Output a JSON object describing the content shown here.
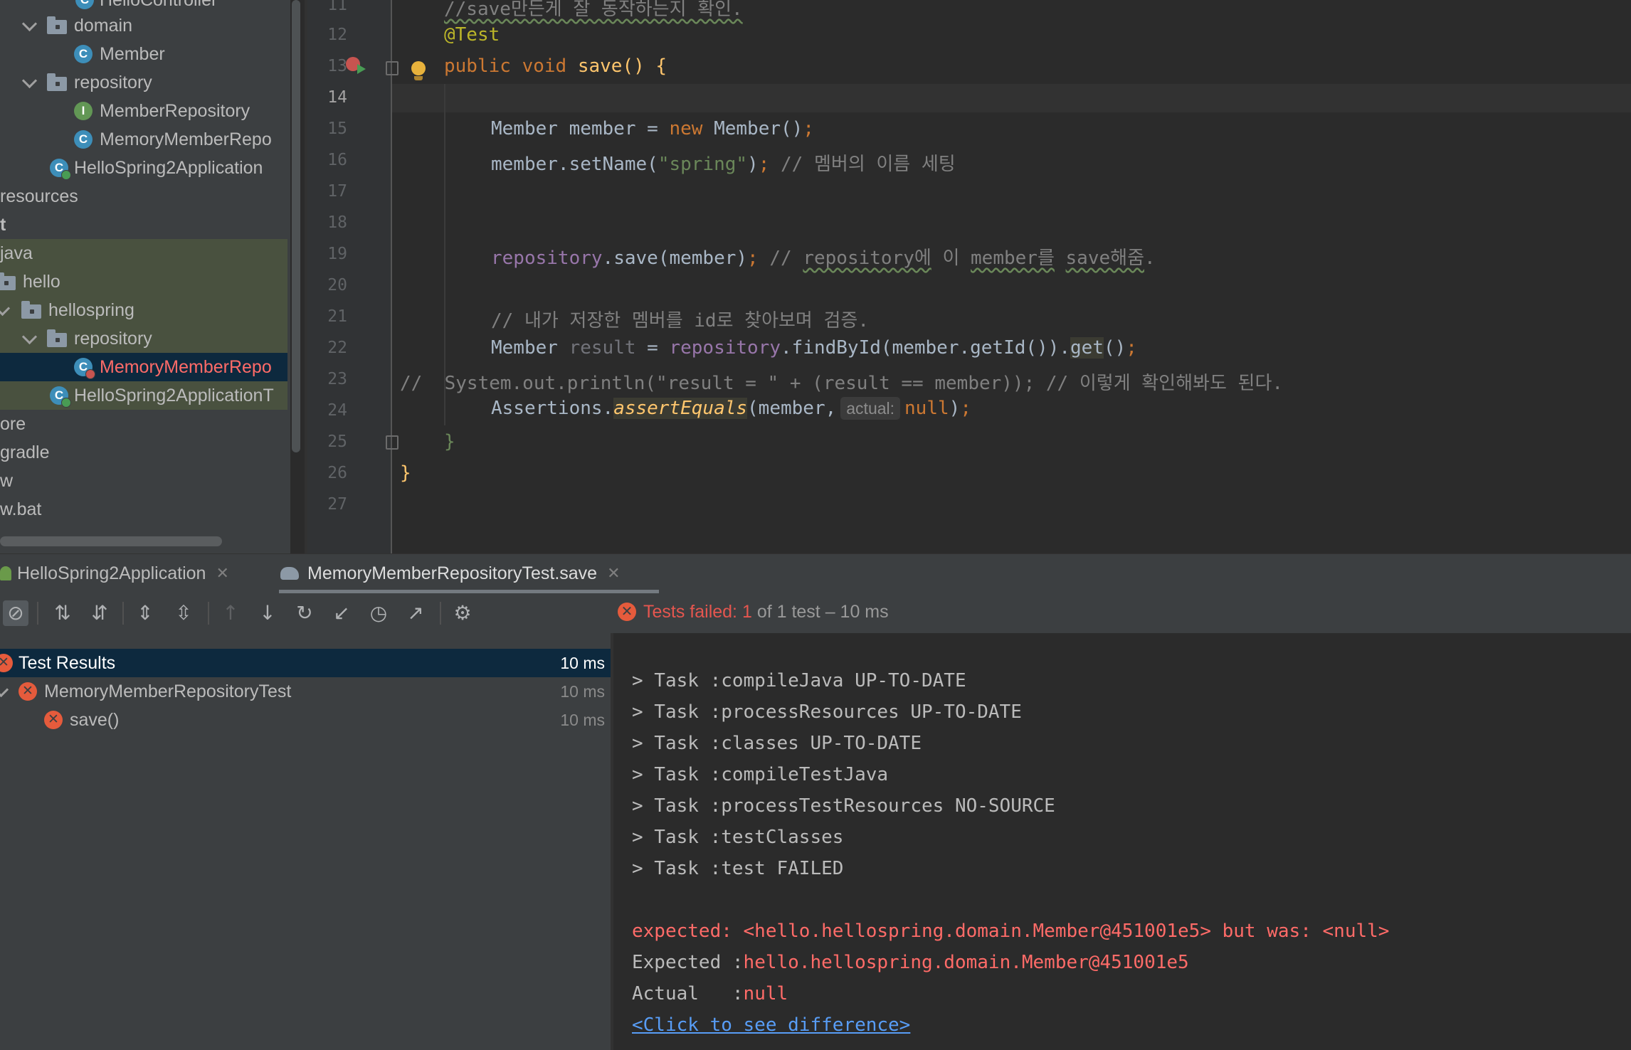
{
  "tree": {
    "items": [
      {
        "label": "HelloController",
        "icon": "class-icon",
        "glyph": "C"
      },
      {
        "label": "domain",
        "icon": "folder-icon"
      },
      {
        "label": "Member",
        "icon": "class-icon",
        "glyph": "C"
      },
      {
        "label": "repository",
        "icon": "folder-icon"
      },
      {
        "label": "MemberRepository",
        "icon": "interface-icon",
        "glyph": "I"
      },
      {
        "label": "MemoryMemberRepo",
        "icon": "class-icon",
        "glyph": "C"
      },
      {
        "label": "HelloSpring2Application",
        "icon": "spring-boot-class-icon",
        "glyph": "C"
      },
      {
        "label": "resources"
      },
      {
        "label": "t"
      },
      {
        "label": "java"
      },
      {
        "label": "hello",
        "icon": "folder-icon"
      },
      {
        "label": "hellospring",
        "icon": "folder-icon"
      },
      {
        "label": "repository",
        "icon": "folder-icon"
      },
      {
        "label": "MemoryMemberRepo",
        "icon": "test-class-icon",
        "glyph": "C"
      },
      {
        "label": "HelloSpring2ApplicationT",
        "icon": "test-class-icon",
        "glyph": "C"
      },
      {
        "label": "ore"
      },
      {
        "label": "gradle"
      },
      {
        "label": "w"
      },
      {
        "label": "w.bat"
      }
    ]
  },
  "editor": {
    "current_line": "14",
    "lines": [
      {
        "n": "11",
        "t": "//save만든게 잘 동작하는지 확인."
      },
      {
        "n": "12",
        "t": "@Test"
      },
      {
        "n": "13",
        "t": "public void save() {"
      },
      {
        "n": "14",
        "t": ""
      },
      {
        "n": "15",
        "t": "Member member = new Member();"
      },
      {
        "n": "16",
        "t": "member.setName(\"spring\"); // 멤버의 이름 세팅"
      },
      {
        "n": "17",
        "t": ""
      },
      {
        "n": "18",
        "t": ""
      },
      {
        "n": "19",
        "t": "repository.save(member); // repository에 이 member를 save해줌."
      },
      {
        "n": "20",
        "t": ""
      },
      {
        "n": "21",
        "t": "// 내가 저장한 멤버를 id로 찾아보며 검증."
      },
      {
        "n": "22",
        "t": "Member result = repository.findById(member.getId()).get();"
      },
      {
        "n": "23",
        "t": "//  System.out.println(\"result = \" + (result == member)); // 이렇게 확인해봐도 된다."
      },
      {
        "n": "24",
        "t": "Assertions.assertEquals(member, actual: null);"
      },
      {
        "n": "25",
        "t": "}"
      },
      {
        "n": "26",
        "t": "}"
      },
      {
        "n": "27",
        "t": ""
      }
    ]
  },
  "run": {
    "tabs": [
      {
        "label": "HelloSpring2Application",
        "icon": "spring-boot-icon"
      },
      {
        "label": "MemoryMemberRepositoryTest.save",
        "icon": "gradle-elephant-icon"
      }
    ],
    "status": {
      "failed_label": "Tests failed: 1",
      "rest": "of 1 test – 10 ms"
    },
    "results": [
      {
        "label": "Test Results",
        "time": "10 ms"
      },
      {
        "label": "MemoryMemberRepositoryTest",
        "time": "10 ms"
      },
      {
        "label": "save()",
        "time": "10 ms"
      }
    ],
    "console": [
      "> Task :compileJava UP-TO-DATE",
      "> Task :processResources UP-TO-DATE",
      "> Task :classes UP-TO-DATE",
      "> Task :compileTestJava",
      "> Task :processTestResources NO-SOURCE",
      "> Task :testClasses",
      "> Task :test FAILED",
      "",
      "expected: <hello.hellospring.domain.Member@451001e5> but was: <null>",
      "Expected :hello.hellospring.domain.Member@451001e5",
      "Actual   :null",
      "<Click to see difference>"
    ],
    "console_labels": {
      "expected": "Expected :",
      "actual": "Actual   :"
    },
    "console_values": {
      "expected": "hello.hellospring.domain.Member@451001e5",
      "actual": "null"
    }
  },
  "colors": {
    "accent_fail": "#e5564f",
    "selection": "#0d293e",
    "test_dir": "#49513f"
  }
}
